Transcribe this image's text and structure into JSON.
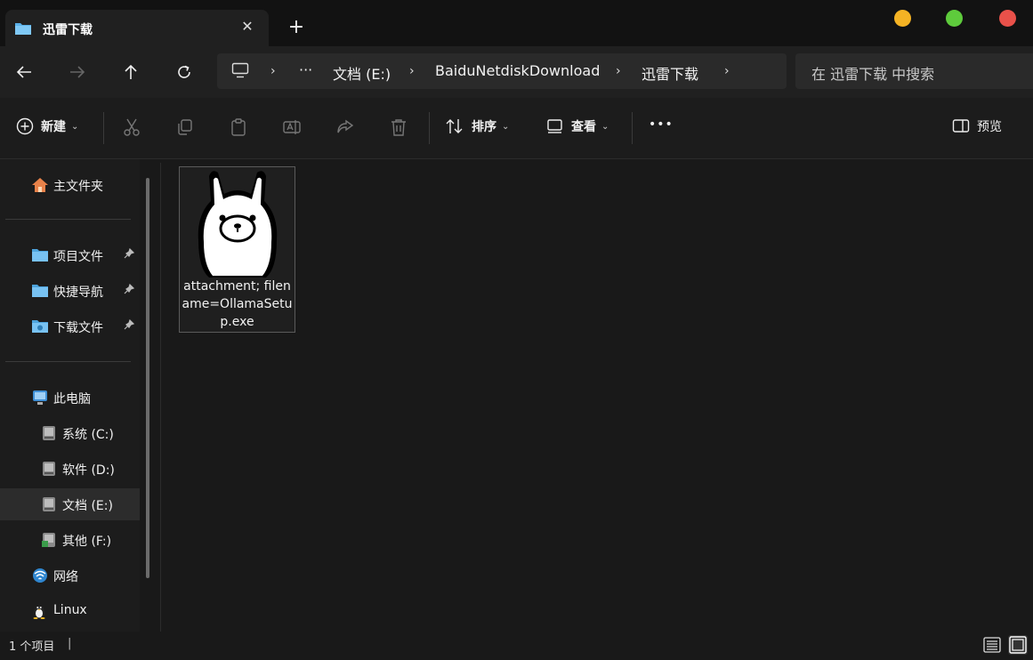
{
  "window": {
    "controls_colors": {
      "minimize": "#f5b324",
      "maximize": "#5ecb3c",
      "close": "#e9514a"
    }
  },
  "tab": {
    "title": "迅雷下载",
    "close_symbol": "✕",
    "new_tab_symbol": "+"
  },
  "address": {
    "ellipsis": "···",
    "segments": [
      "文档 (E:)",
      "BaiduNetdiskDownload",
      "迅雷下载"
    ]
  },
  "search": {
    "placeholder": "在 迅雷下载 中搜索"
  },
  "toolbar": {
    "new_label": "新建",
    "sort_label": "排序",
    "view_label": "查看",
    "more_label": "•••",
    "preview_label": "预览",
    "icons": [
      "cut-icon",
      "copy-icon",
      "paste-icon",
      "rename-icon",
      "share-icon",
      "delete-icon"
    ]
  },
  "sidebar": {
    "home": "主文件夹",
    "quick": [
      {
        "label": "项目文件",
        "pin": "📌"
      },
      {
        "label": "快捷导航",
        "pin": "📌"
      },
      {
        "label": "下载文件",
        "pin": "📌"
      }
    ],
    "this_pc": "此电脑",
    "drives": [
      "系统 (C:)",
      "软件 (D:)",
      "文档 (E:)",
      "其他 (F:)"
    ],
    "network": "网络",
    "linux": "Linux"
  },
  "files": [
    {
      "name": "attachment; filename=OllamaSetup.exe",
      "icon": "ollama-llama-icon"
    }
  ],
  "status": {
    "count": "1 个项目",
    "sep": "|"
  }
}
